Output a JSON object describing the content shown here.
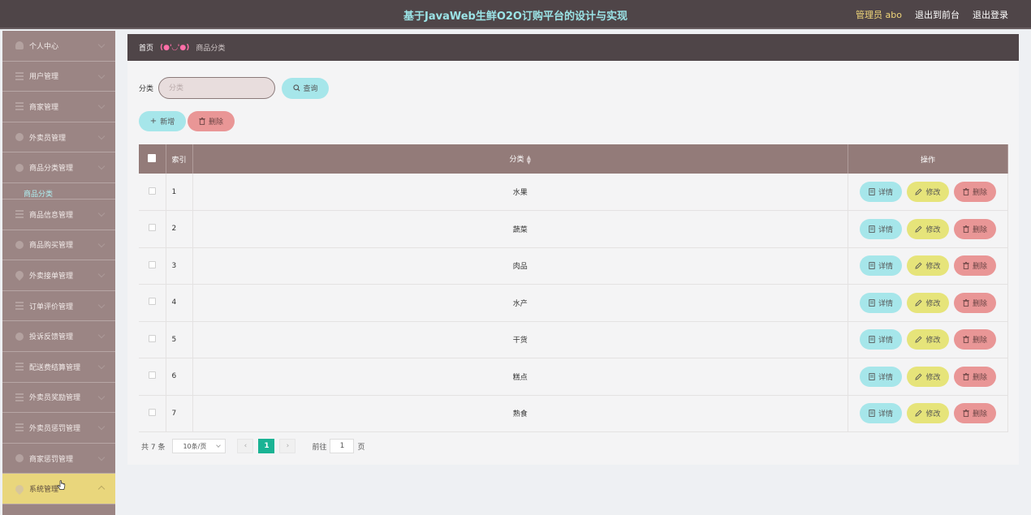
{
  "header": {
    "title": "基于JavaWeb生鲜O2O订购平台的设计与实现",
    "admin_label": "管理员 abo",
    "front_link": "退出到前台",
    "logout_link": "退出登录"
  },
  "sidebar": {
    "items": [
      {
        "label": "个人中心",
        "icon": "user-icon"
      },
      {
        "label": "用户管理",
        "icon": "list-icon"
      },
      {
        "label": "商家管理",
        "icon": "list-icon"
      },
      {
        "label": "外卖员管理",
        "icon": "circle-icon"
      },
      {
        "label": "商品分类管理",
        "icon": "circle-icon"
      },
      {
        "label": "商品信息管理",
        "icon": "list-icon"
      },
      {
        "label": "商品购买管理",
        "icon": "circle-icon"
      },
      {
        "label": "外卖接单管理",
        "icon": "pin-icon"
      },
      {
        "label": "订单评价管理",
        "icon": "list-icon"
      },
      {
        "label": "投诉反馈管理",
        "icon": "circle-icon"
      },
      {
        "label": "配送费结算管理",
        "icon": "list-icon"
      },
      {
        "label": "外卖员奖励管理",
        "icon": "list-icon"
      },
      {
        "label": "外卖员惩罚管理",
        "icon": "list-icon"
      },
      {
        "label": "商家惩罚管理",
        "icon": "circle-icon"
      },
      {
        "label": "系统管理",
        "icon": "pin-icon"
      }
    ],
    "sub_item": "商品分类"
  },
  "breadcrumb": {
    "home": "首页",
    "face": "(●'◡'●)",
    "current": "商品分类"
  },
  "search": {
    "label": "分类",
    "placeholder": "分类",
    "button": "查询"
  },
  "actions": {
    "add": "新增",
    "delete": "删除"
  },
  "table": {
    "headers": {
      "index": "索引",
      "category": "分类",
      "operation": "操作"
    },
    "rows": [
      {
        "index": "1",
        "category": "水果"
      },
      {
        "index": "2",
        "category": "蔬菜"
      },
      {
        "index": "3",
        "category": "肉品"
      },
      {
        "index": "4",
        "category": "水产"
      },
      {
        "index": "5",
        "category": "干货"
      },
      {
        "index": "6",
        "category": "糕点"
      },
      {
        "index": "7",
        "category": "熟食"
      }
    ],
    "row_buttons": {
      "detail": "详情",
      "edit": "修改",
      "delete": "删除"
    }
  },
  "pagination": {
    "total": "共 7 条",
    "page_size": "10条/页",
    "prev": "‹",
    "current_page": "1",
    "next": "›",
    "goto_prefix": "前往",
    "goto_value": "1",
    "goto_suffix": "页"
  },
  "colors": {
    "topbar": "#4f4548",
    "sidebar": "#9b8584",
    "active_menu": "#e9d67c",
    "accent_cyan": "#a6e6ea",
    "accent_red": "#e99696",
    "accent_yellow": "#e6e47a",
    "page_active": "#1ab394"
  }
}
